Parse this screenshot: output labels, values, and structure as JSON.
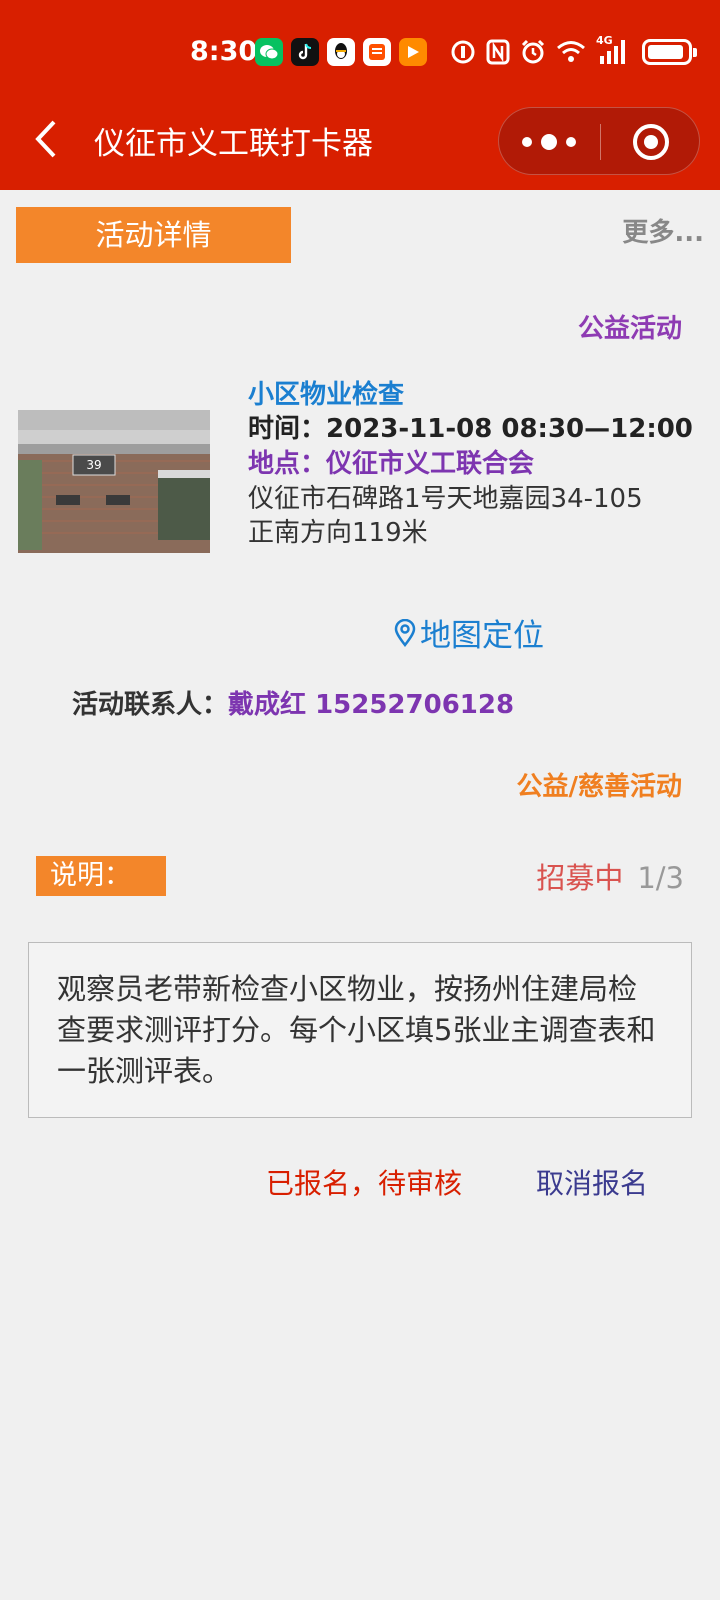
{
  "status_bar": {
    "time": "8:30",
    "app_icons": [
      "wechat-icon",
      "tiktok-icon",
      "qq-icon",
      "taobao-icon",
      "video-icon"
    ],
    "system_icons": [
      "data-saver-icon",
      "nfc-icon",
      "alarm-icon",
      "wifi-icon",
      "signal-4g-icon",
      "battery-icon"
    ],
    "signal_label": "4G"
  },
  "nav": {
    "title": "仪征市义工联打卡器",
    "back_icon": "chevron-left-icon",
    "more_icon": "more-dots-icon",
    "close_icon": "target-close-icon"
  },
  "tabs": {
    "detail_label": "活动详情",
    "more_label": "更多..."
  },
  "activity": {
    "category_top": "公益活动",
    "title": "小区物业检查",
    "time_label": "时间：",
    "time_value": "2023-11-08 08:30—12:00",
    "place_label": "地点：",
    "place_value": "仪征市义工联合会",
    "address_line1": "仪征市石碑路1号天地嘉园34-105",
    "address_line2": "正南方向119米",
    "map_label": "地图定位",
    "contact_label": "活动联系人：",
    "contact_value": "戴成红 15252706128",
    "category_bottom": "公益/慈善活动",
    "building_sign": "39"
  },
  "description": {
    "tag": "说明：",
    "status": "招募中",
    "page": "1/3",
    "text": "观察员老带新检查小区物业，按扬州住建局检查要求测评打分。每个小区填5张业主调查表和一张测评表。"
  },
  "signup": {
    "status": "已报名，待审核",
    "cancel_label": "取消报名"
  },
  "colors": {
    "header": "#d81f00",
    "orange": "#f3862a",
    "purple": "#7d35b0",
    "blue": "#1b7fd0"
  }
}
